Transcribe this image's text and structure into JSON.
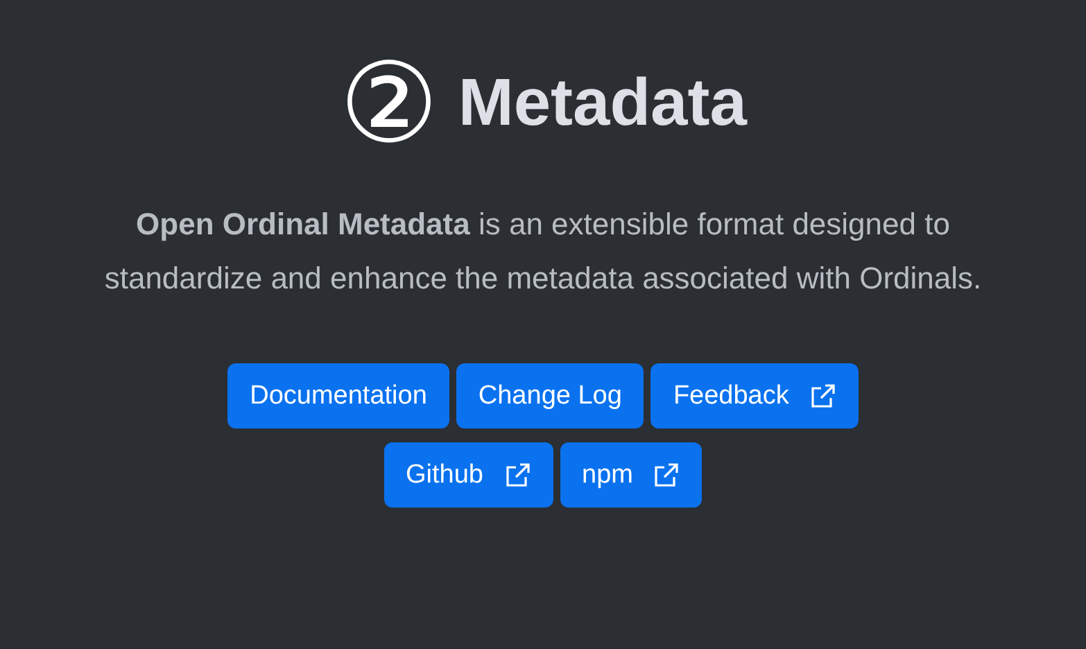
{
  "title": {
    "badge": "②",
    "text": "Metadata"
  },
  "description": "**Open Ordinal Metadata** is an extensible format designed to standardize and enhance the metadata associated with Ordinals.",
  "button_rows": [
    [
      {
        "label": "Documentation",
        "external": false
      },
      {
        "label": "Change Log",
        "external": false
      },
      {
        "label": "Feedback",
        "external": true
      }
    ],
    [
      {
        "label": "Github",
        "external": true
      },
      {
        "label": "npm",
        "external": true
      }
    ]
  ]
}
